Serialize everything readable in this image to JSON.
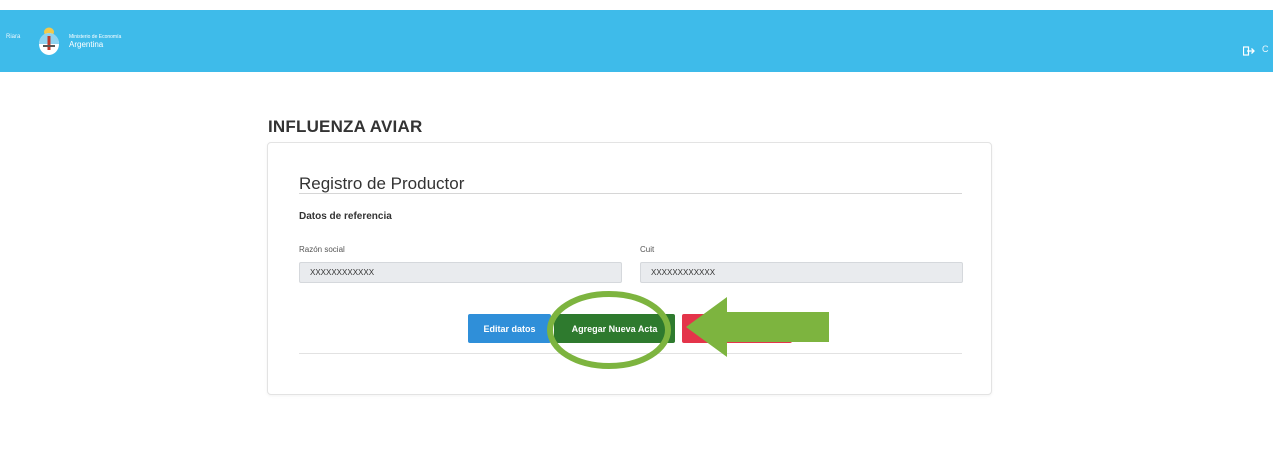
{
  "header": {
    "cut_text_left": "Riara",
    "ministry_label": "Ministerio de Economía",
    "country_label": "Argentina",
    "logout_cut_text": "C"
  },
  "page": {
    "title": "INFLUENZA AVIAR"
  },
  "form": {
    "title": "Registro de Productor",
    "section_title": "Datos de referencia",
    "razon_social": {
      "label": "Razón social",
      "value": "XXXXXXXXXXXX"
    },
    "cuit": {
      "label": "Cuit",
      "value": "XXXXXXXXXXXX"
    },
    "buttons": {
      "edit_label": "Editar datos",
      "add_label": "Agregar Nueva Acta",
      "third_label": ""
    }
  },
  "colors": {
    "header_bg": "#3ebbea",
    "edit_button": "#2f8fd9",
    "add_button": "#2e7a2e",
    "third_button": "#e4344a",
    "annotation_green": "#7db43f"
  },
  "icons": {
    "logo": "national-coat-of-arms",
    "logout": "sign-out-icon",
    "annotation_arrow": "left-arrow",
    "annotation_circle": "highlight-ellipse"
  }
}
